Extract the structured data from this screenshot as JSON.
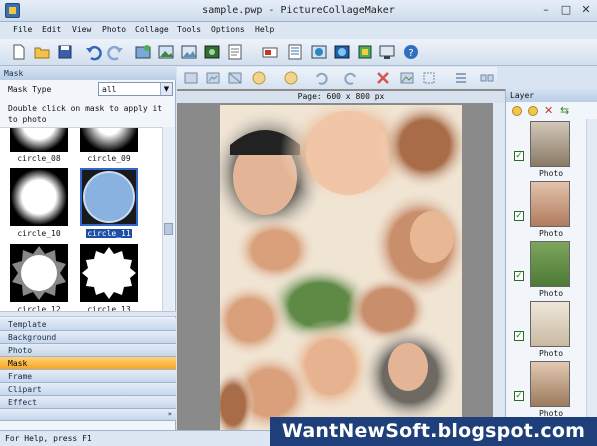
{
  "window": {
    "title": "sample.pwp - PictureCollageMaker",
    "controls": [
      "–",
      "□",
      "✕"
    ]
  },
  "menu": [
    "File",
    "Edit",
    "View",
    "Photo",
    "Collage",
    "Tools",
    "Options",
    "Help"
  ],
  "toolbar_icons": [
    "new-icon",
    "open-icon",
    "save-icon",
    "undo-icon",
    "redo-icon",
    "add-photo-icon",
    "image-icon",
    "print-icon",
    "slideshow-icon",
    "document-icon",
    "text-icon",
    "export-icon",
    "share-icon",
    "web-icon",
    "settings-icon",
    "help-icon"
  ],
  "left_panel": {
    "header": "Mask",
    "mask_type_label": "Mask Type",
    "mask_type_value": "all",
    "hint": "Double click on mask to apply it to photo",
    "masks": [
      {
        "name": "circle_08",
        "selected": false
      },
      {
        "name": "circle_09",
        "selected": false
      },
      {
        "name": "circle_10",
        "selected": false
      },
      {
        "name": "circle_11",
        "selected": true
      },
      {
        "name": "circle_12",
        "selected": false
      },
      {
        "name": "circle_13",
        "selected": false
      }
    ],
    "sections": [
      "Template",
      "Background",
      "Photo",
      "Mask",
      "Frame",
      "Clipart",
      "Effect"
    ],
    "active_section": "Mask"
  },
  "canvas": {
    "page_label": "Page: 600 x 800 px"
  },
  "layer_panel": {
    "header": "Layer",
    "layers": [
      "Photo",
      "Photo",
      "Photo",
      "Photo",
      "Photo"
    ]
  },
  "status": "For Help, press F1",
  "watermark": "WantNewSoft.blogspot.com",
  "colors": {
    "active_section": "#f5a623",
    "selection": "#1d4fa5",
    "watermark_bg": "#1e3f7a"
  }
}
